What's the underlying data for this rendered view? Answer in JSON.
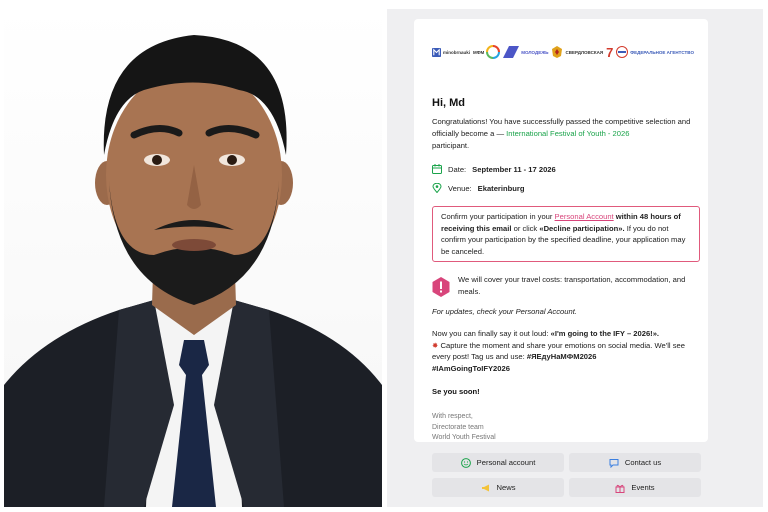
{
  "logos": {
    "logo1": "minobrnauki",
    "logo2": "МФМ",
    "logo3": "МОЛОДЕЖЬ",
    "logo4": "СВЕРДЛОВСКАЯ",
    "logo5": "7",
    "logo6": "ФЕДЕРАЛЬНОЕ АГЕНТСТВО"
  },
  "email": {
    "greeting": "Hi, Md",
    "congrats_prefix": "Congratulations! You have successfully passed the competitive selection and officially become a — ",
    "festival_name": "International Festival of Youth - 2026",
    "congrats_suffix": "participant.",
    "date_label": "Date:",
    "date_value": "September 11 - 17 2026",
    "venue_label": "Venue:",
    "venue_value": "Ekaterinburg",
    "confirm_1": "Confirm your participation in your ",
    "confirm_link": "Personal Account",
    "confirm_2": " within 48 hours of receiving this email",
    "confirm_3": " or click ",
    "confirm_4": "«Decline participation».",
    "confirm_5": " If you do not confirm your participation by the specified deadline, your application may be canceled.",
    "travel": "We will cover your travel costs: transportation, accommodation, and meals.",
    "updates": "For updates, check your Personal Account.",
    "loud_1": "Now you can finally say it out loud: ",
    "loud_2": "«I'm going to the IFY – 2026!».",
    "loud_3": "Capture the moment and share your emotions on social media. We'll see every post! Tag us and use: ",
    "hashtag_1": "#ЯЕдуНаМФМ2026",
    "hashtag_2": "#IAmGoingToIFY2026",
    "see_you": "Se you soon!",
    "respect_1": "With respect,",
    "respect_2": "Directorate team",
    "respect_3": "World Youth Festival"
  },
  "buttons": {
    "personal": "Personal account",
    "contact": "Contact us",
    "news": "News",
    "events": "Events"
  },
  "colors": {
    "accent_green": "#1aa34a",
    "accent_pink": "#d8457b",
    "panel_bg": "#efeff1"
  },
  "icons": {
    "date": "calendar-icon",
    "venue": "location-pin-icon",
    "travel": "alert-hexagon-icon",
    "personal": "smiley-icon",
    "contact": "chat-bubble-icon",
    "news": "megaphone-icon",
    "events": "gift-icon"
  }
}
